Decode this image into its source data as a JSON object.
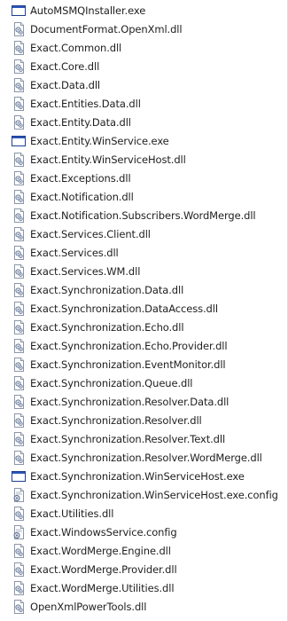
{
  "files": [
    {
      "name": "AutoMSMQInstaller.exe",
      "icon": "exe-window-icon"
    },
    {
      "name": "DocumentFormat.OpenXml.dll",
      "icon": "dll-file-icon"
    },
    {
      "name": "Exact.Common.dll",
      "icon": "dll-file-icon"
    },
    {
      "name": "Exact.Core.dll",
      "icon": "dll-file-icon"
    },
    {
      "name": "Exact.Data.dll",
      "icon": "dll-file-icon"
    },
    {
      "name": "Exact.Entities.Data.dll",
      "icon": "dll-file-icon"
    },
    {
      "name": "Exact.Entity.Data.dll",
      "icon": "dll-file-icon"
    },
    {
      "name": "Exact.Entity.WinService.exe",
      "icon": "exe-window-icon"
    },
    {
      "name": "Exact.Entity.WinServiceHost.dll",
      "icon": "dll-file-icon"
    },
    {
      "name": "Exact.Exceptions.dll",
      "icon": "dll-file-icon"
    },
    {
      "name": "Exact.Notification.dll",
      "icon": "dll-file-icon"
    },
    {
      "name": "Exact.Notification.Subscribers.WordMerge.dll",
      "icon": "dll-file-icon"
    },
    {
      "name": "Exact.Services.Client.dll",
      "icon": "dll-file-icon"
    },
    {
      "name": "Exact.Services.dll",
      "icon": "dll-file-icon"
    },
    {
      "name": "Exact.Services.WM.dll",
      "icon": "dll-file-icon"
    },
    {
      "name": "Exact.Synchronization.Data.dll",
      "icon": "dll-file-icon"
    },
    {
      "name": "Exact.Synchronization.DataAccess.dll",
      "icon": "dll-file-icon"
    },
    {
      "name": "Exact.Synchronization.Echo.dll",
      "icon": "dll-file-icon"
    },
    {
      "name": "Exact.Synchronization.Echo.Provider.dll",
      "icon": "dll-file-icon"
    },
    {
      "name": "Exact.Synchronization.EventMonitor.dll",
      "icon": "dll-file-icon"
    },
    {
      "name": "Exact.Synchronization.Queue.dll",
      "icon": "dll-file-icon"
    },
    {
      "name": "Exact.Synchronization.Resolver.Data.dll",
      "icon": "dll-file-icon"
    },
    {
      "name": "Exact.Synchronization.Resolver.dll",
      "icon": "dll-file-icon"
    },
    {
      "name": "Exact.Synchronization.Resolver.Text.dll",
      "icon": "dll-file-icon"
    },
    {
      "name": "Exact.Synchronization.Resolver.WordMerge.dll",
      "icon": "dll-file-icon"
    },
    {
      "name": "Exact.Synchronization.WinServiceHost.exe",
      "icon": "exe-window-icon"
    },
    {
      "name": "Exact.Synchronization.WinServiceHost.exe.config",
      "icon": "config-file-icon"
    },
    {
      "name": "Exact.Utilities.dll",
      "icon": "dll-file-icon"
    },
    {
      "name": "Exact.WindowsService.config",
      "icon": "config-file-icon"
    },
    {
      "name": "Exact.WordMerge.Engine.dll",
      "icon": "dll-file-icon"
    },
    {
      "name": "Exact.WordMerge.Provider.dll",
      "icon": "dll-file-icon"
    },
    {
      "name": "Exact.WordMerge.Utilities.dll",
      "icon": "dll-file-icon"
    },
    {
      "name": "OpenXmlPowerTools.dll",
      "icon": "dll-file-icon"
    }
  ],
  "colors": {
    "text": "#1e1e1e",
    "exe_frame": "#1f3f8f",
    "gear": "#6a7c9a",
    "page_border": "#8a96a8"
  }
}
